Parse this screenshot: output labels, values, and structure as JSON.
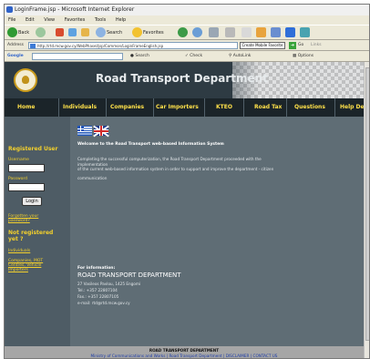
{
  "browser": {
    "title": "LoginFrame.jsp - Microsoft Internet Explorer",
    "menu": [
      "File",
      "Edit",
      "View",
      "Favorites",
      "Tools",
      "Help"
    ],
    "toolbar": {
      "back": "Back",
      "search": "Search",
      "favorites": "Favorites"
    },
    "address": {
      "label": "Address",
      "url": "http://rtd.mcw.gov.cy/WebPhaseI/jsp/Common/LoginFrameEnglish.jsp",
      "mobile_button": "Create Mobile Favorite",
      "go": "Go",
      "links": "Links"
    },
    "googlebar": {
      "logo": "Google",
      "search": "Search",
      "check": "Check",
      "autolink": "AutoLink",
      "options": "Options"
    }
  },
  "site": {
    "title": "Road Transport Department",
    "nav": [
      "Home",
      "Individuals",
      "Companies",
      "Car Importers",
      "KTEO",
      "Road Tax",
      "Questions",
      "Help Desk"
    ],
    "sidebar": {
      "registered_heading": "Registered User",
      "username_label": "Username",
      "password_label": "Password",
      "login_button": "Login",
      "forgot_link": [
        "Forgotten your",
        "password?"
      ],
      "not_registered_heading": [
        "Not registered",
        "yet ?"
      ],
      "individuals_link": "Individuals",
      "companies_link": [
        "Companies, MOT",
        "Centres, Vehicle",
        "Importers"
      ]
    },
    "main": {
      "welcome": "Welcome to the Road Transport web-based Information System",
      "paragraph": [
        "Completing the successful computerization, the  Road  Transport  Department proceeded with the",
        "implementation",
        "of the current web-based information system in order to support and improve the department - citizen",
        "communication"
      ],
      "info_heading": "For information:",
      "department": "ROAD TRANSPORT DEPARTMENT",
      "address": "27 Vasileos Pavlou, 1425 Engomi",
      "tel": "Tel.: +357 22807104",
      "fax": "Fax.: +357 22807105",
      "email": "e-mail: rtd@rtd.mcw.gov.cy"
    },
    "footer": {
      "title": "ROAD TRANSPORT DEPARTMENT",
      "links": [
        "Ministry of Communications and Works",
        "Road Transport Department",
        "DISCLAIMER",
        "CONTACT US"
      ]
    }
  }
}
